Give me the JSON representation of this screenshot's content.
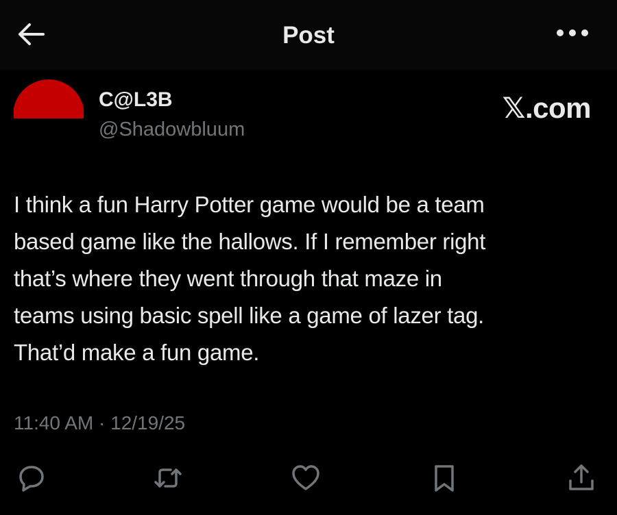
{
  "header": {
    "title": "Post",
    "back_icon": "arrow-left-icon",
    "more_icon": "more-horizontal-icon"
  },
  "author": {
    "display_name": "C@L3B",
    "handle": "@Shadowbluum",
    "avatar_color": "#c40000"
  },
  "brand": {
    "label": "𝕏.com"
  },
  "post": {
    "text": "I think a fun Harry Potter game would be a team\nbased game like the hallows. If I remember right\nthat’s where they went through that maze in\nteams using basic spell like a game of lazer tag.\nThat’d make a fun game.",
    "time": "11:40 AM",
    "separator": " · ",
    "date": "12/19/25"
  },
  "actions": [
    {
      "icon": "reply-icon"
    },
    {
      "icon": "repost-icon"
    },
    {
      "icon": "like-icon"
    },
    {
      "icon": "bookmark-icon"
    },
    {
      "icon": "share-icon"
    }
  ],
  "colors": {
    "background": "#000000",
    "text_primary": "#e7e9ea",
    "text_secondary": "#71767b"
  }
}
